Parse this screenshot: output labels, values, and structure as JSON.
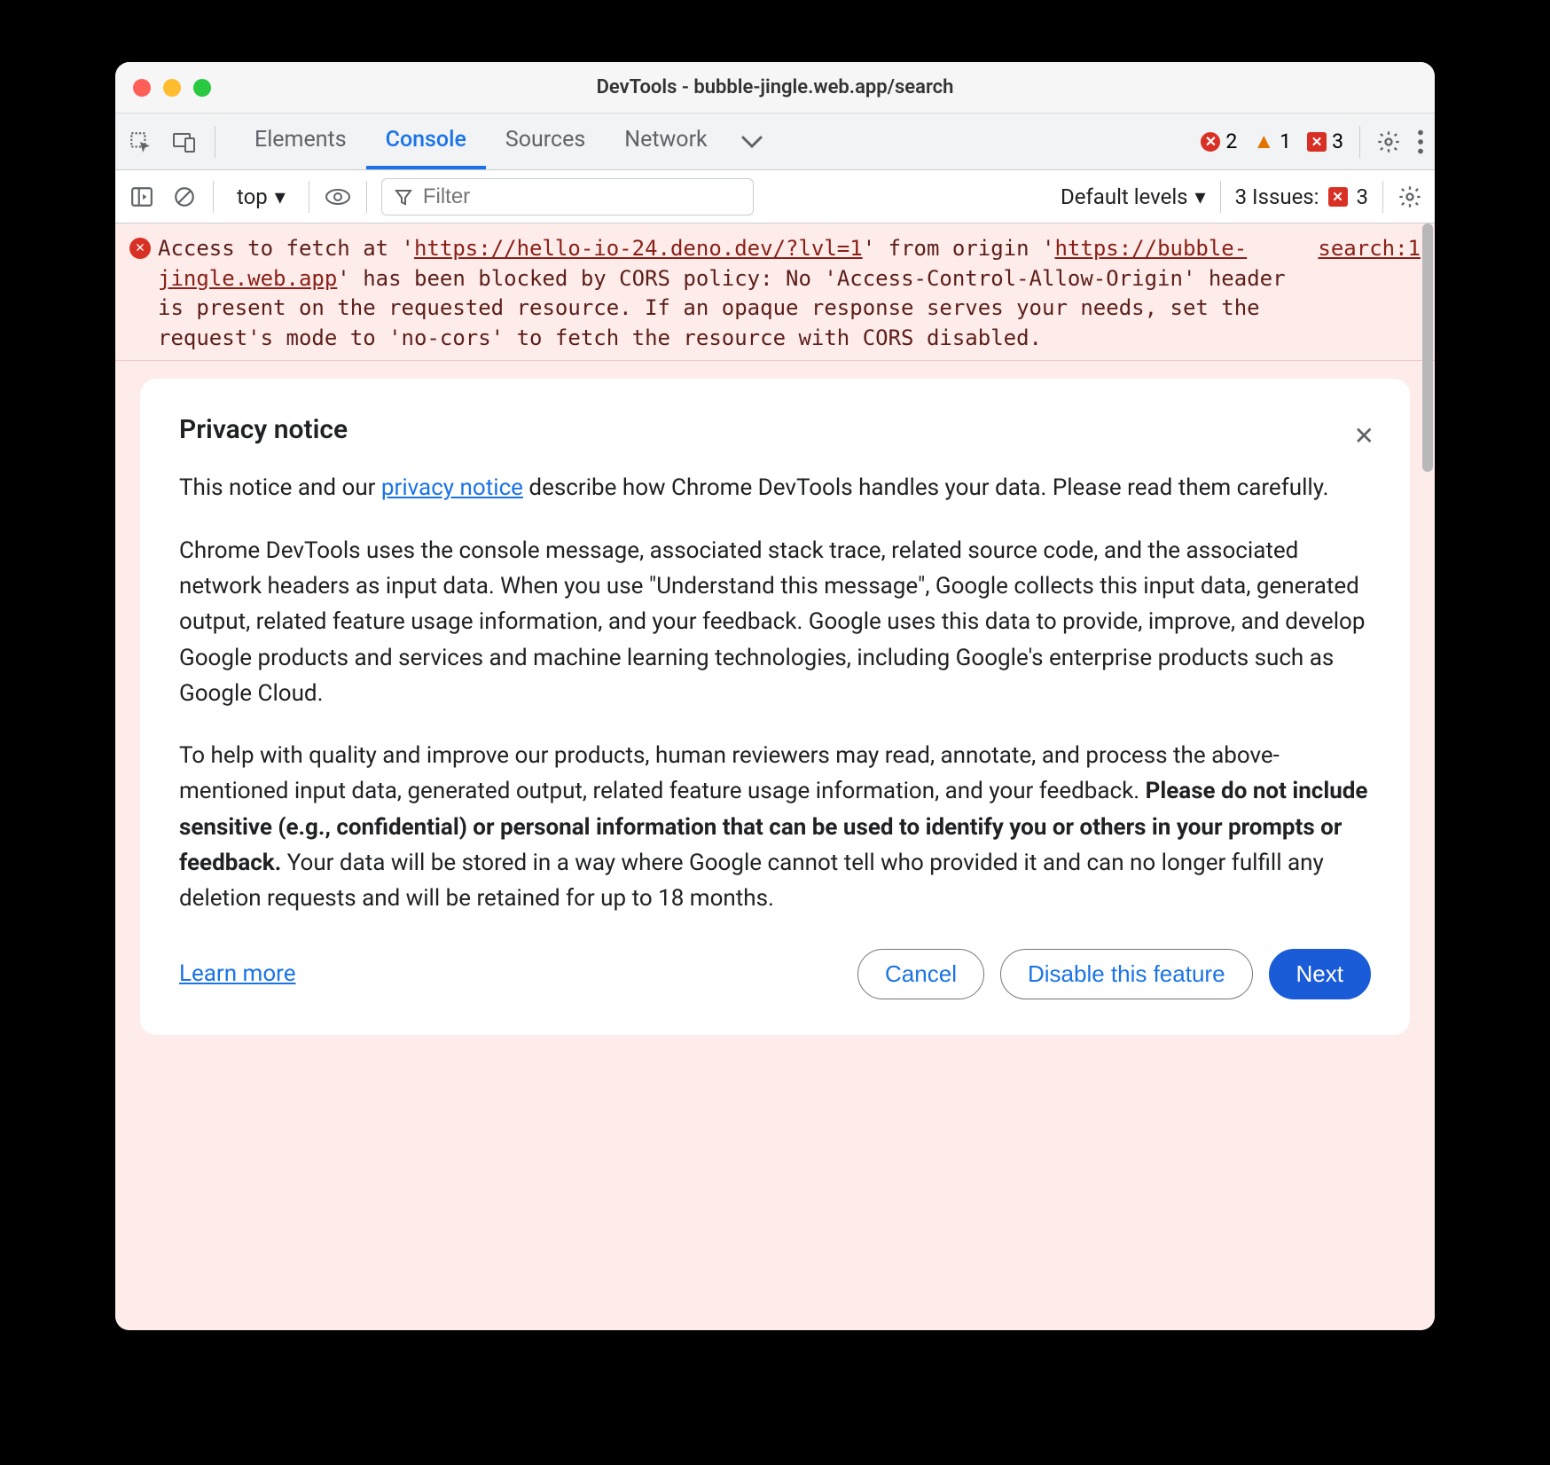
{
  "window": {
    "title": "DevTools - bubble-jingle.web.app/search"
  },
  "tabs": {
    "items": [
      "Elements",
      "Console",
      "Sources",
      "Network"
    ],
    "active_index": 1
  },
  "status": {
    "errors": 2,
    "warnings": 1,
    "issues_tab": 3
  },
  "toolbar": {
    "context": "top",
    "filter_placeholder": "Filter",
    "levels_label": "Default levels",
    "issues_label": "3 Issues:",
    "issues_count": 3
  },
  "console_error": {
    "prefix": "Access to fetch at '",
    "url1": "https://hello-io-24.deno.dev/?lvl=1",
    "mid1": "' from origin '",
    "url2": "https://bubble-jingle.web.app",
    "rest": "' has been blocked by CORS policy: No 'Access-Control-Allow-Origin' header is present on the requested resource. If an opaque response serves your needs, set the request's mode to 'no-cors' to fetch the resource with CORS disabled.",
    "source": "search:1"
  },
  "notice": {
    "title": "Privacy notice",
    "p1_a": "This notice and our ",
    "p1_link": "privacy notice",
    "p1_b": " describe how Chrome DevTools handles your data. Please read them carefully.",
    "p2": "Chrome DevTools uses the console message, associated stack trace, related source code, and the associated network headers as input data. When you use \"Understand this message\", Google collects this input data, generated output, related feature usage information, and your feedback. Google uses this data to provide, improve, and develop Google products and services and machine learning technologies, including Google's enterprise products such as Google Cloud.",
    "p3_a": "To help with quality and improve our products, human reviewers may read, annotate, and process the above-mentioned input data, generated output, related feature usage information, and your feedback. ",
    "p3_bold": "Please do not include sensitive (e.g., confidential) or personal information that can be used to identify you or others in your prompts or feedback.",
    "p3_b": " Your data will be stored in a way where Google cannot tell who provided it and can no longer fulfill any deletion requests and will be retained for up to 18 months.",
    "learn_more": "Learn more",
    "cancel": "Cancel",
    "disable": "Disable this feature",
    "next": "Next"
  }
}
